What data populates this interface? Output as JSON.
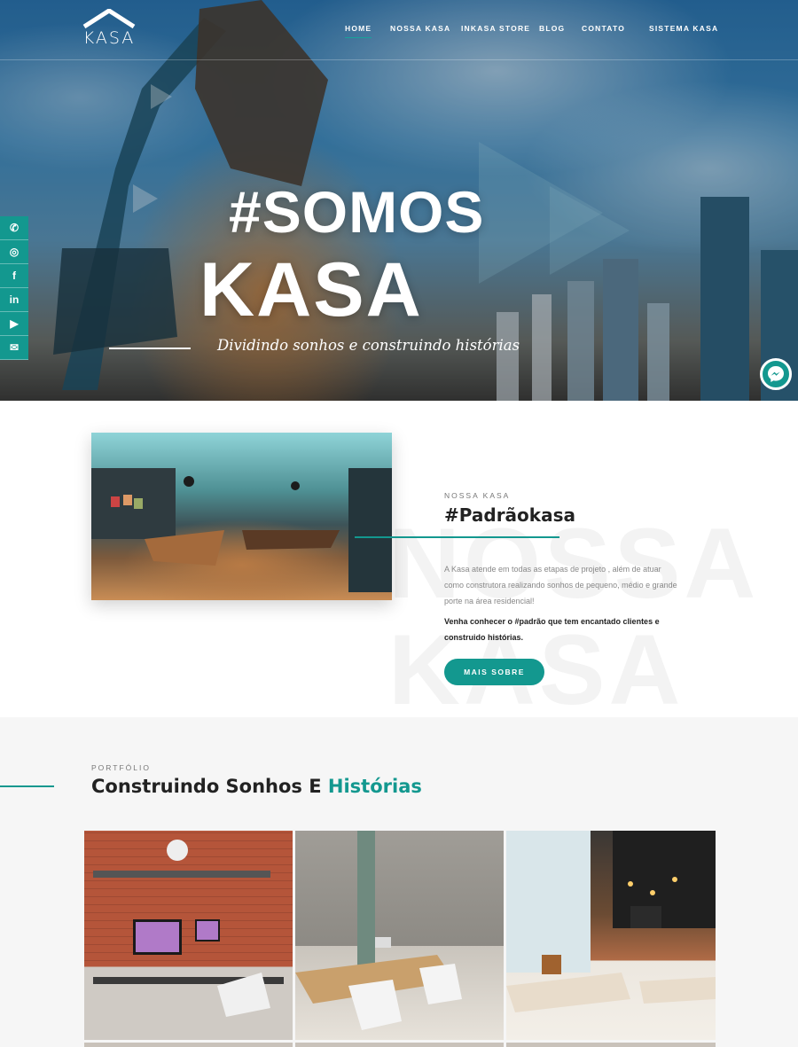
{
  "brand": {
    "logo_text": "KASA"
  },
  "nav": {
    "items": [
      {
        "label": "HOME",
        "active": true
      },
      {
        "label": "NOSSA KASA",
        "active": false
      },
      {
        "label": "INKASA STORE",
        "active": false
      },
      {
        "label": "BLOG",
        "active": false
      },
      {
        "label": "CONTATO",
        "active": false
      }
    ],
    "system_label": "SISTEMA KASA"
  },
  "hero": {
    "title_line1": "#SOMOS",
    "title_line2": "KASA",
    "subtitle": "Dividindo sonhos e construindo histórias"
  },
  "social": {
    "icons": [
      "whatsapp-icon",
      "instagram-icon",
      "facebook-icon",
      "linkedin-icon",
      "youtube-icon",
      "email-icon"
    ],
    "glyphs": [
      "✆",
      "◎",
      "f",
      "in",
      "▶",
      "✉"
    ]
  },
  "about": {
    "eyebrow": "NOSSA KASA",
    "heading": "#Padrãokasa",
    "body": "A Kasa atende em todas as etapas de projeto , além de atuar como construtora realizando sonhos de pequeno, médio e grande porte na área residencial!",
    "strong": "Venha conhecer o #padrão que tem encantado clientes e construido histórias.",
    "button_label": "MAIS SOBRE",
    "watermark_line1": "NOSSA",
    "watermark_line2": "KASA"
  },
  "portfolio": {
    "eyebrow": "PORTFÓLIO",
    "heading_plain": "Construindo Sonhos E ",
    "heading_accent": "Histórias"
  },
  "colors": {
    "accent": "#13988f",
    "text": "#222222",
    "muted": "#888888"
  }
}
